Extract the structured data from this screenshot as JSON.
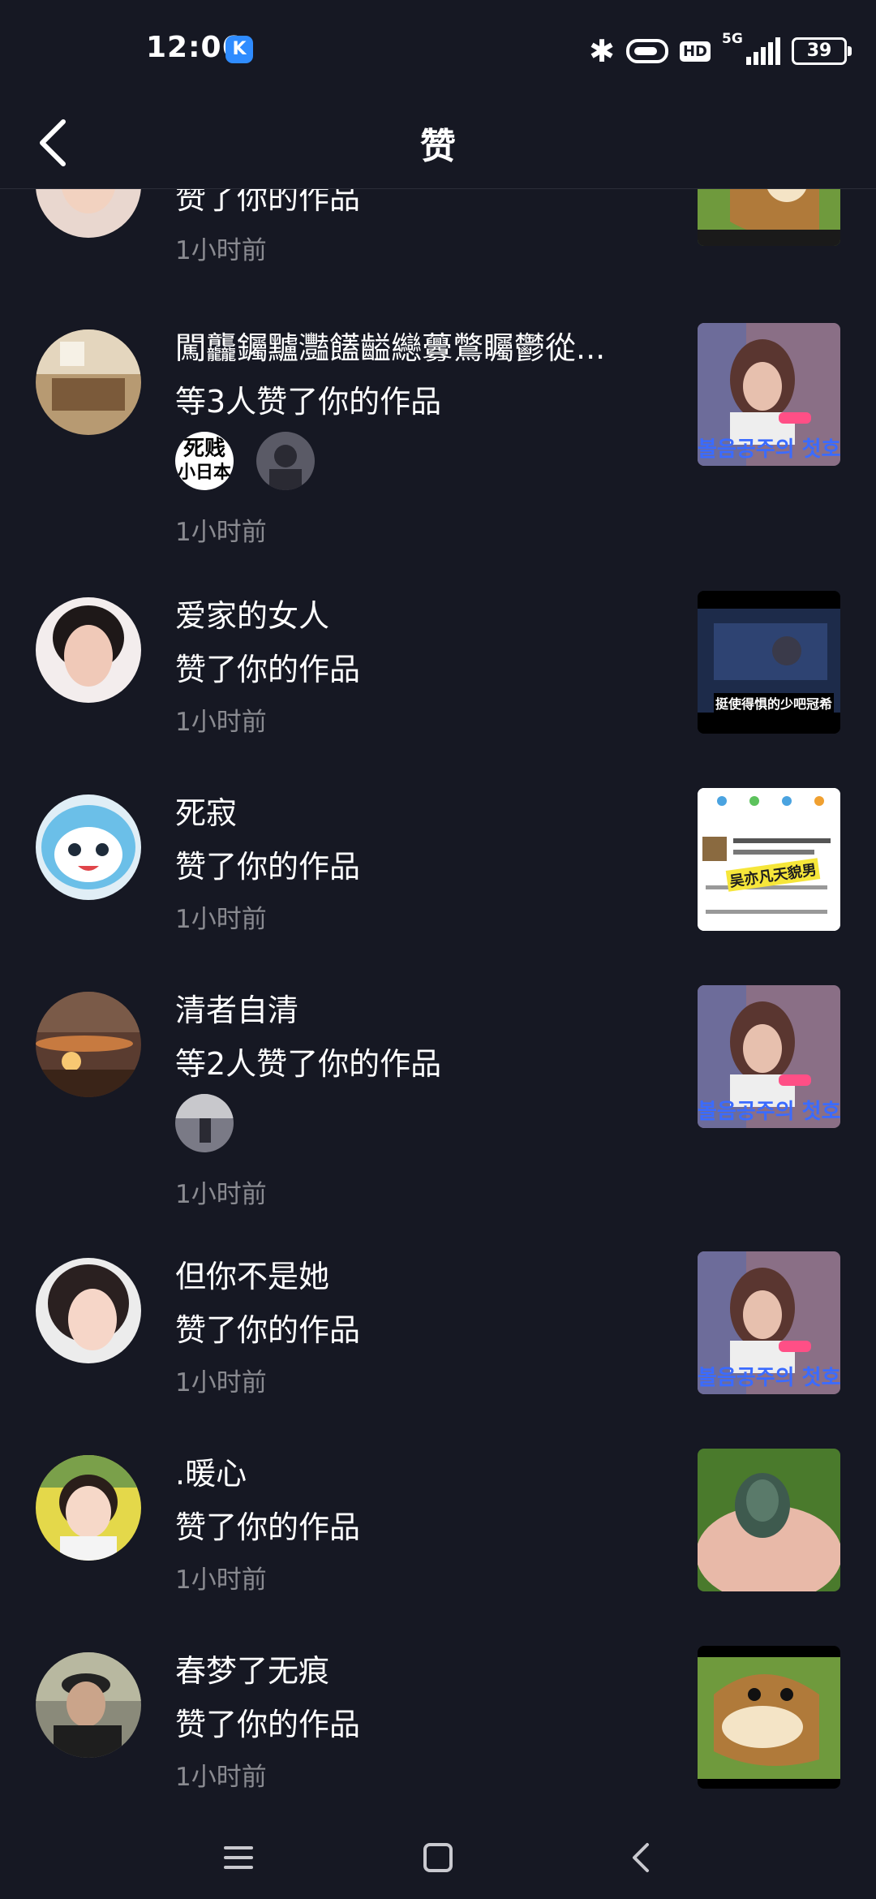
{
  "status_bar": {
    "time": "12:06",
    "app_badge": "K",
    "network": "5G",
    "hd": "HD",
    "battery": "39"
  },
  "header": {
    "title": "赞"
  },
  "items": [
    {
      "name": "",
      "action": "赞了你的作品",
      "time": "1小时前"
    },
    {
      "name": "闖龘钃黸灩饚齸纞虋鷩矚鬱從...",
      "action": "等3人赞了你的作品",
      "time": "1小时前",
      "small_avatar_text": [
        "死贱",
        "小日本"
      ]
    },
    {
      "name": "爱家的女人",
      "action": "赞了你的作品",
      "time": "1小时前",
      "thumb_caption": "挺使得惧的少吧冠希"
    },
    {
      "name": "死寂",
      "action": "赞了你的作品",
      "time": "1小时前",
      "thumb_caption": "吴亦凡天貌男"
    },
    {
      "name": "清者自清",
      "action": "等2人赞了你的作品",
      "time": "1小时前"
    },
    {
      "name": "但你不是她",
      "action": "赞了你的作品",
      "time": "1小时前"
    },
    {
      "name": ".暖心",
      "action": "赞了你的作品",
      "time": "1小时前"
    },
    {
      "name": "春梦了无痕",
      "action": "赞了你的作品",
      "time": "1小时前"
    }
  ],
  "thumb_texts": {
    "korean": "볼음공주의 첫호"
  },
  "colors": {
    "background": "#161823",
    "secondary_text": "#8a8b91",
    "divider": "#2b2d38"
  }
}
